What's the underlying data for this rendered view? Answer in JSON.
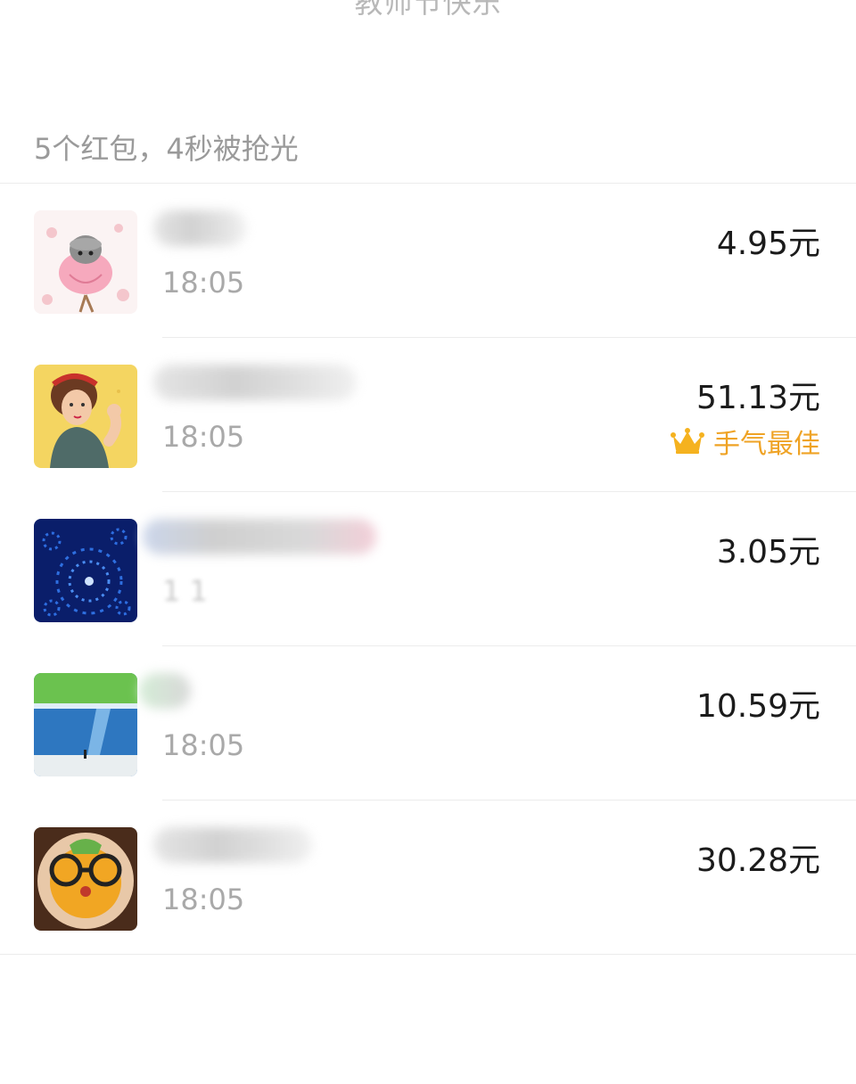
{
  "header": {
    "title": "教师节快乐"
  },
  "summary": {
    "text": "5个红包，4秒被抢光"
  },
  "records": [
    {
      "time": "18:05",
      "amount": "4.95元"
    },
    {
      "time": "18:05",
      "amount": "51.13元",
      "badge": "手气最佳"
    },
    {
      "time": "1 1",
      "amount": "3.05元"
    },
    {
      "time": "18:05",
      "amount": "10.59元"
    },
    {
      "time": "18:05",
      "amount": "30.28元"
    }
  ],
  "colors": {
    "amount": "#1b1b1b",
    "badge": "#efa325",
    "secondary_text": "#a9a9a9",
    "divider": "#ececec"
  },
  "icons": {
    "badge_icon": "crown-icon"
  }
}
